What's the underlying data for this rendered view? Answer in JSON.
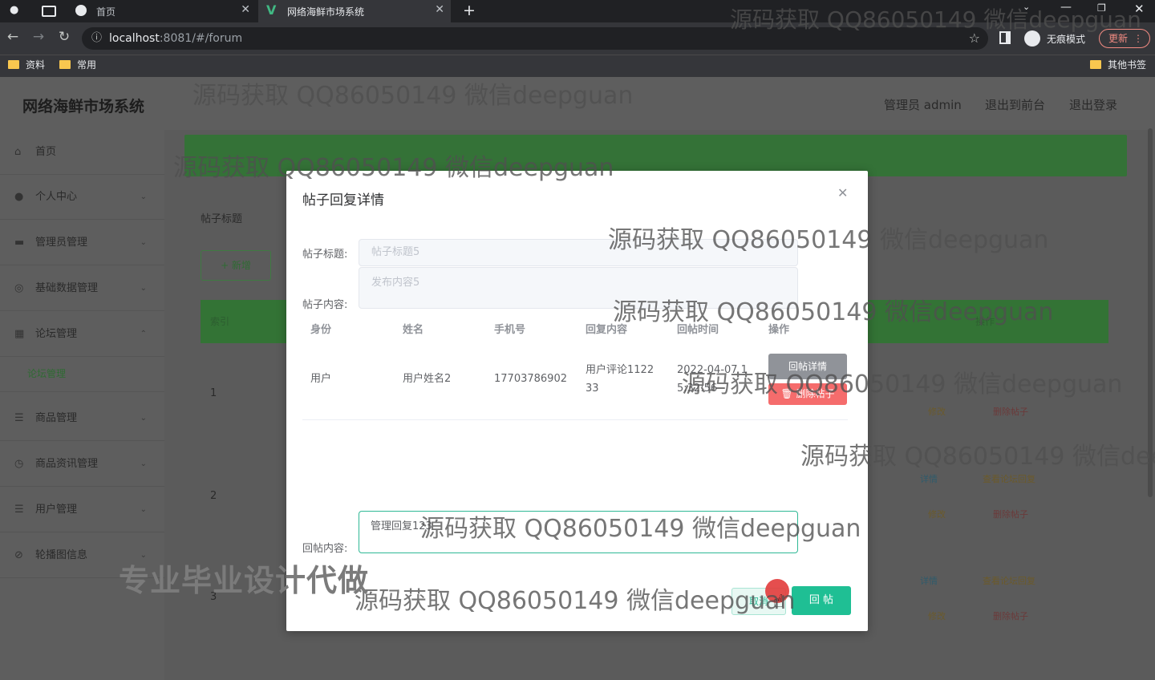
{
  "browser": {
    "tabs": [
      {
        "label": "首页"
      },
      {
        "label": "网络海鲜市场系统"
      }
    ],
    "url_host": "localhost",
    "url_rest": ":8081/#/forum",
    "incognito_label": "无痕模式",
    "update_label": "更新",
    "bookmarks": [
      "资料",
      "常用"
    ],
    "other_bookmarks": "其他书签"
  },
  "app": {
    "title": "网络海鲜市场系统",
    "header_links": [
      "管理员 admin",
      "退出到前台",
      "退出登录"
    ],
    "sidebar": [
      {
        "label": "首页",
        "icon": "home-icon"
      },
      {
        "label": "个人中心",
        "icon": "user-icon"
      },
      {
        "label": "管理员管理",
        "icon": "admin-icon"
      },
      {
        "label": "基础数据管理",
        "icon": "data-icon"
      },
      {
        "label": "论坛管理",
        "icon": "forum-icon"
      },
      {
        "label": "论坛管理",
        "icon": ""
      },
      {
        "label": "商品管理",
        "icon": "goods-icon"
      },
      {
        "label": "商品资讯管理",
        "icon": "news-icon"
      },
      {
        "label": "用户管理",
        "icon": "users-icon"
      },
      {
        "label": "轮播图信息",
        "icon": "carousel-icon"
      }
    ],
    "search_label": "帖子标题",
    "add_button": "+ 新增",
    "table_header_left": "索引",
    "table_header_right": "操作",
    "row_numbers": [
      "1",
      "2",
      "3"
    ],
    "row_actions": [
      "详情",
      "修改",
      "删除帖子",
      "查看论坛回复"
    ]
  },
  "dialog": {
    "title": "帖子回复详情",
    "post_title_label": "帖子标题:",
    "post_title_value": "帖子标题5",
    "post_content_label": "帖子内容:",
    "post_content_value": "发布内容5",
    "table_headers": [
      "身份",
      "姓名",
      "手机号",
      "回复内容",
      "回帖时间",
      "操作"
    ],
    "rows": [
      {
        "identity": "用户",
        "name": "用户姓名2",
        "phone": "17703786902",
        "content": "用户评论1122 33",
        "time": "2022-04-07 1 5:32:56",
        "detail_button": "回帖详情",
        "delete_button": "删除帖子"
      }
    ],
    "reply_label": "回帖内容:",
    "reply_value": "管理回复123",
    "cancel_button": "取消",
    "submit_button": "回 帖"
  },
  "watermarks": {
    "text": "源码获取 QQ86050149 微信deepguan",
    "promo": "专业毕业设计代做"
  }
}
